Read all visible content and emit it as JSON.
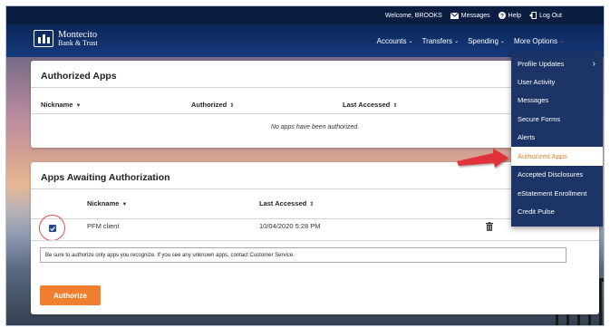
{
  "topbar": {
    "welcome": "Welcome, BROOKS",
    "messages": "Messages",
    "help": "Help",
    "logout": "Log Out"
  },
  "brand": {
    "line1": "Montecito",
    "line2": "Bank & Trust"
  },
  "nav": {
    "accounts": "Accounts",
    "transfers": "Transfers",
    "spending": "Spending",
    "more": "More Options"
  },
  "dropdown": {
    "items": [
      "Profile Updates",
      "User Activity",
      "Messages",
      "Secure Forms",
      "Alerts",
      "Authorized Apps",
      "Accepted Disclosures",
      "eStatement Enrollment",
      "Credit Pulse"
    ],
    "active": "Authorized Apps"
  },
  "authorized": {
    "title": "Authorized Apps",
    "columns": [
      "Nickname",
      "Authorized",
      "Last Accessed"
    ],
    "empty": "No apps have been authorized."
  },
  "awaiting": {
    "title": "Apps Awaiting Authorization",
    "columns": [
      "Nickname",
      "Last Accessed"
    ],
    "rows": [
      {
        "nickname": "PFM client",
        "last_accessed": "10/04/2020 5:28 PM",
        "checked": true
      }
    ],
    "notice": "Be sure to authorize only apps you recognize. If you see any unknown apps, contact Customer Service.",
    "button": "Authorize"
  },
  "colors": {
    "accent": "#ef7f2e",
    "navy": "#0c1d42",
    "menu": "#1d3566",
    "highlight": "#e05050"
  }
}
